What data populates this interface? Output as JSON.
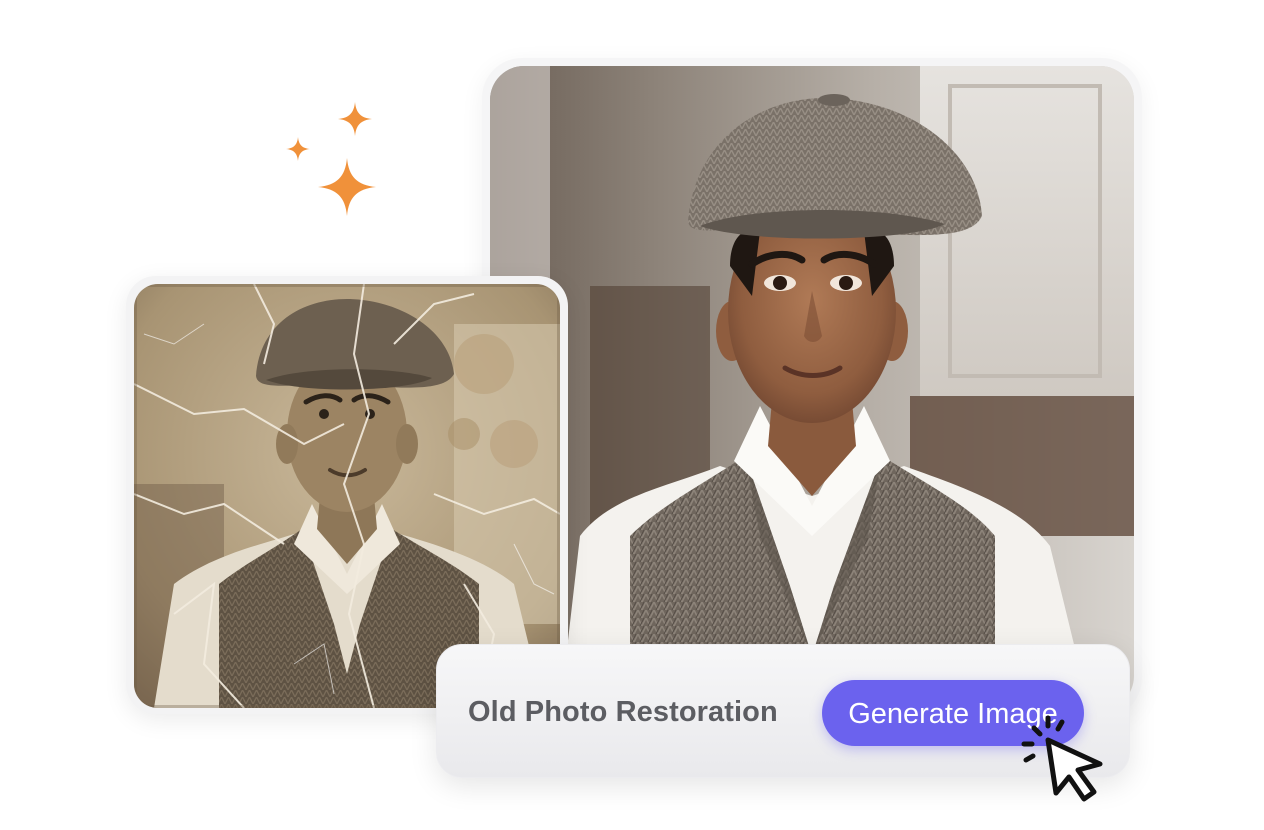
{
  "action_bar": {
    "title": "Old Photo Restoration",
    "button_label": "Generate Image"
  },
  "icons": {
    "sparkles": "sparkle-icon",
    "cursor": "cursor-click-icon"
  },
  "colors": {
    "accent": "#6b62ee",
    "sparkle": "#f0913a",
    "label_text": "#5c5d62"
  }
}
